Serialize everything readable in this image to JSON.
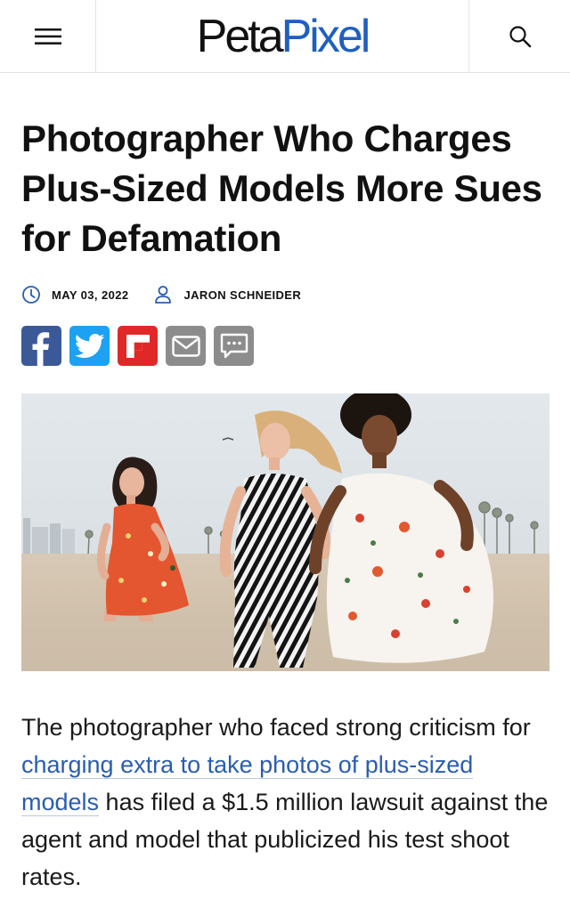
{
  "header": {
    "logo_part1": "Peta",
    "logo_part2": "Pixel",
    "menu_icon": "hamburger-menu-icon",
    "search_icon": "search-icon"
  },
  "article": {
    "title": "Photographer Who Charges Plus-Sized Models More Sues for Defamation",
    "date": "MAY 03, 2022",
    "author": "JARON SCHNEIDER",
    "share_icons": [
      "facebook-icon",
      "twitter-icon",
      "flipboard-icon",
      "email-icon",
      "comment-icon"
    ],
    "body_before_link": "The photographer who faced strong criticism for ",
    "body_link": "charging extra to take photos of plus-sized models",
    "body_after_link": " has filed a $1.5 million lawsuit against the agent and model that publicized his test shoot rates."
  },
  "colors": {
    "brand_blue": "#1f5fbf",
    "link_blue": "#2a5db0",
    "facebook": "#3b5998",
    "twitter": "#1da1f2",
    "flipboard": "#e12828",
    "grey": "#8c8c8c"
  }
}
